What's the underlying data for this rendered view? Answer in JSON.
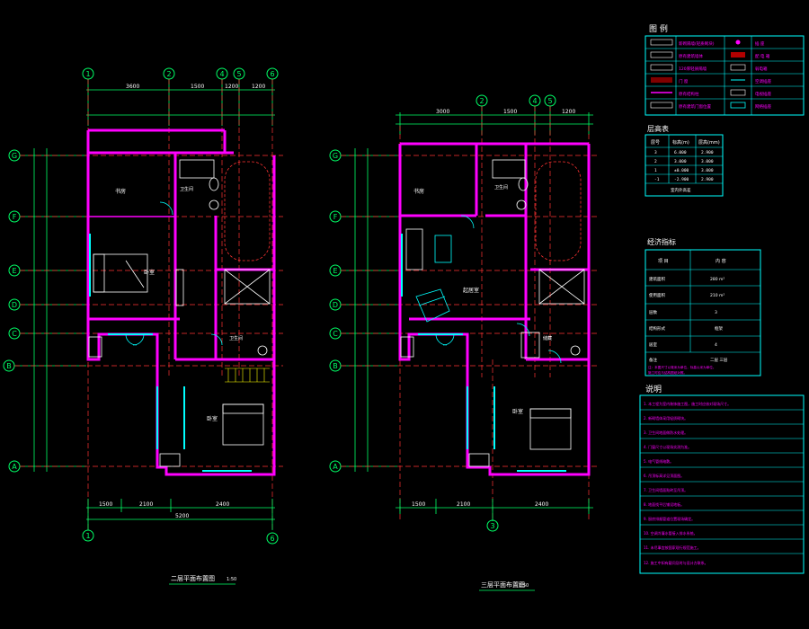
{
  "colors": {
    "background": "#000000",
    "wall": "#ff00ff",
    "grid": "#ff3333",
    "dimension": "#00ff66",
    "fixture": "#ffffff",
    "window": "#00ffff",
    "stair": "#ffff00",
    "panel": "#00ffff"
  },
  "plan_left": {
    "title": "二层平面布置图",
    "scale": "1:50",
    "axes_top": [
      "1",
      "2",
      "4",
      "5",
      "6"
    ],
    "axes_bottom": [
      "1",
      "6"
    ],
    "axes_left": [
      "G",
      "F",
      "E",
      "D",
      "C",
      "B",
      "A"
    ],
    "rooms": {
      "study": "书房",
      "bedroom1": "卧室",
      "bath": "卫生间",
      "bedroom2": "卧室",
      "wc": "卫生间"
    }
  },
  "plan_right": {
    "title": "三层平面布置图",
    "scale": "1:50",
    "axes_top": [
      "2",
      "4",
      "5"
    ],
    "axes_bottom": [
      "3"
    ],
    "axes_left": [
      "G",
      "F",
      "E",
      "D",
      "C",
      "B",
      "A"
    ],
    "rooms": {
      "study": "书房",
      "family": "起居室",
      "bedroom": "卧室",
      "wc": "卫生间",
      "store": "储藏"
    }
  },
  "legend": {
    "title": "图 例",
    "rows": [
      [
        "新砌隔墙(轻质砌块)",
        "插 座"
      ],
      [
        "原有建筑墙体",
        "配 电 箱"
      ],
      [
        "120厚轻质隔墙",
        "弱电箱"
      ],
      [
        "门 窗",
        "空调插座"
      ],
      [
        "原有结构柱",
        "电视插座"
      ],
      [
        "原有建筑门窗位置",
        "网络插座"
      ]
    ]
  },
  "floor_table": {
    "title": "层高表",
    "headers": [
      "层号",
      "标高(m)",
      "层高(mm)"
    ],
    "rows": [
      [
        "3",
        "6.000",
        "2.900"
      ],
      [
        "2",
        "3.000",
        "3.000"
      ],
      [
        "1",
        "±0.000",
        "3.000"
      ],
      [
        "-1",
        "-2.900",
        "2.900"
      ]
    ],
    "footer": "室内外高差"
  },
  "tech_table": {
    "title": "经济指标",
    "headers": [
      "项 目",
      "内 容"
    ],
    "rows": [
      [
        "建筑面积",
        "280 m²"
      ],
      [
        "使用面积",
        "210 m²"
      ],
      [
        "层数",
        "3"
      ],
      [
        "结构形式",
        "框架"
      ],
      [
        "居室",
        "4"
      ],
      [
        "备注",
        "二层 三层"
      ]
    ],
    "notes": [
      "注：本图尺寸以毫米为单位，标高以米为单位。",
      "施工时应与结构图纸对照。"
    ]
  },
  "notes": {
    "title": "说明",
    "lines": [
      "1. 本工程为室内装饰施工图，施工时应核对现场尺寸。",
      "2. 新砌墙体采用轻质砌块。",
      "3. 卫生间地面做防水处理。",
      "4. 门窗尺寸以现场实测为准。",
      "5. 电气管线暗敷。",
      "6. 吊顶标高详见顶面图。",
      "7. 卫生间墙面贴砖至吊顶。",
      "8. 地面找平后铺设地板。",
      "9. 厨房排烟管道位置现场确定。",
      "10. 空调冷凝水管接入排水系统。",
      "11. 未尽事宜按国家现行规范施工。",
      "12. 施工中如有疑问及时与设计方联系。"
    ]
  },
  "dims": {
    "left_top": [
      "3600",
      "1500",
      "1200",
      "1200"
    ],
    "left_bottom": [
      "1500",
      "2100",
      "2400"
    ],
    "left_total": "5200",
    "right_top": [
      "3000",
      "1500",
      "1200"
    ],
    "right_bottom": [
      "1500",
      "2100",
      "2400"
    ]
  }
}
